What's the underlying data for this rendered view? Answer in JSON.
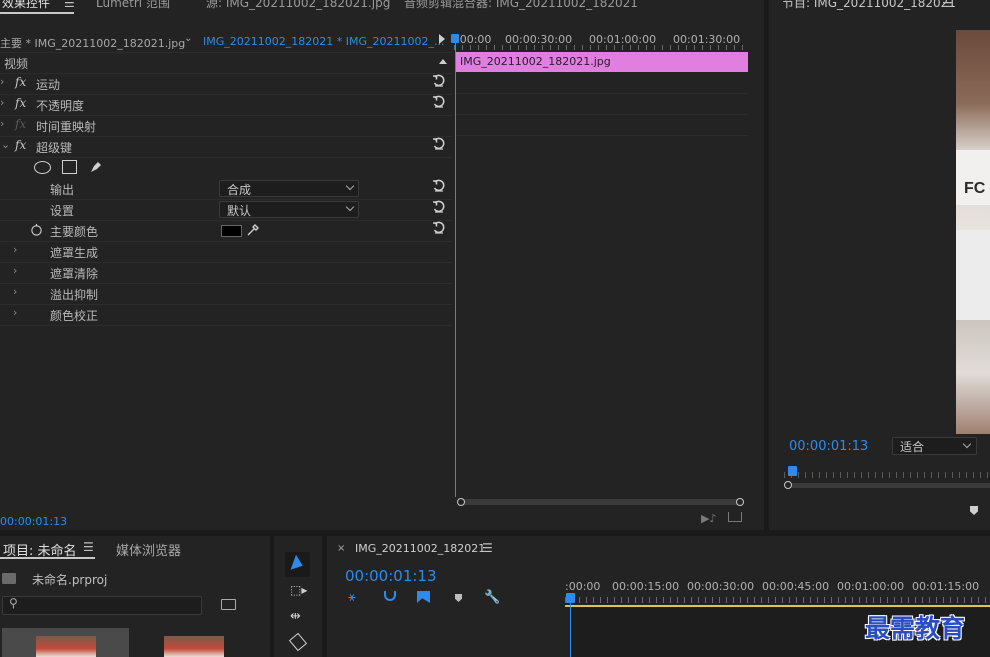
{
  "effect_controls": {
    "tabs": [
      "效果控件",
      "Lumetri 范围",
      "源: IMG_20211002_182021.jpg",
      "音频剪辑混合器: IMG_20211002_182021"
    ],
    "source_label": "主要 * IMG_20211002_182021.jpg",
    "sequence_label": "IMG_20211002_182021 * IMG_20211002_...",
    "section_label": "视频",
    "effects": [
      "运动",
      "不透明度",
      "时间重映射",
      "超级键"
    ],
    "output_label": "输出",
    "output_value": "合成",
    "setting_label": "设置",
    "setting_value": "默认",
    "key_color_label": "主要颜色",
    "sub_groups": [
      "遮罩生成",
      "遮罩清除",
      "溢出抑制",
      "颜色校正"
    ],
    "ruler": [
      ":00:00",
      "00:00:30:00",
      "00:01:00:00",
      "00:01:30:00"
    ],
    "clip_name": "IMG_20211002_182021.jpg",
    "timecode": "00:00:01:13"
  },
  "program_monitor": {
    "title": "节目: IMG_20211002_182021",
    "timecode": "00:00:01:13",
    "zoom": "适合"
  },
  "project": {
    "title": "项目: 未命名",
    "media_tab": "媒体浏览器",
    "file_name": "未命名.prproj"
  },
  "timeline": {
    "title": "IMG_20211002_182021",
    "timecode": "00:00:01:13",
    "ruler": [
      ":00:00",
      "00:00:15:00",
      "00:00:30:00",
      "00:00:45:00",
      "00:01:00:00",
      "00:01:15:00"
    ]
  },
  "watermark": "最需教育",
  "colors": {
    "accent": "#2d8ceb",
    "clip": "#e07fdf",
    "panel": "#232323"
  }
}
